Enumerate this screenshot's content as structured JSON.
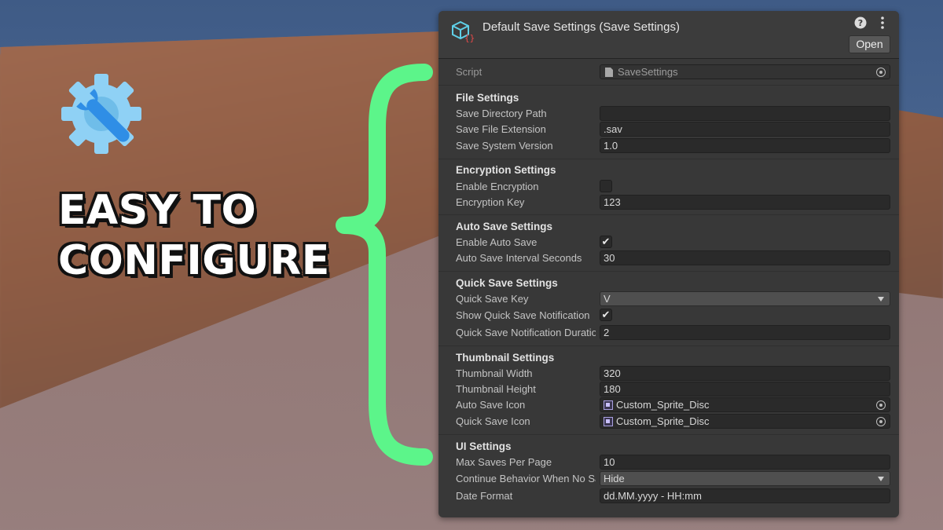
{
  "headline": {
    "line1": "EASY TO",
    "line2": "CONFIGURE"
  },
  "icons": {
    "gear": "gear-wrench-icon",
    "brace": "curly-brace-icon",
    "cube": "scriptable-object-icon",
    "help": "help-icon",
    "more": "more-options-icon"
  },
  "colors": {
    "brace": "#5cf58a",
    "gear": "#8fd1f5",
    "wrench": "#2f8ee6",
    "panel": "#383838"
  },
  "panel": {
    "title": "Default Save Settings (Save Settings)",
    "open_label": "Open",
    "script": {
      "label": "Script",
      "value": "SaveSettings"
    },
    "file": {
      "title": "File Settings",
      "dir_label": "Save Directory Path",
      "dir_value": "",
      "ext_label": "Save File Extension",
      "ext_value": ".sav",
      "ver_label": "Save System Version",
      "ver_value": "1.0"
    },
    "encryption": {
      "title": "Encryption Settings",
      "enable_label": "Enable Encryption",
      "enable_checked": false,
      "key_label": "Encryption Key",
      "key_value": "123"
    },
    "autosave": {
      "title": "Auto Save Settings",
      "enable_label": "Enable Auto Save",
      "enable_checked": true,
      "check": "✔",
      "interval_label": "Auto Save Interval Seconds",
      "interval_value": "30"
    },
    "quicksave": {
      "title": "Quick Save Settings",
      "key_label": "Quick Save Key",
      "key_value": "V",
      "notif_label": "Show Quick Save Notification",
      "notif_checked": true,
      "check": "✔",
      "duration_label": "Quick Save Notification Duratio",
      "duration_value": "2"
    },
    "thumbnail": {
      "title": "Thumbnail Settings",
      "width_label": "Thumbnail Width",
      "width_value": "320",
      "height_label": "Thumbnail Height",
      "height_value": "180",
      "autoicon_label": "Auto Save Icon",
      "autoicon_value": "Custom_Sprite_Disc",
      "quickicon_label": "Quick Save Icon",
      "quickicon_value": "Custom_Sprite_Disc"
    },
    "ui": {
      "title": "UI Settings",
      "maxsaves_label": "Max Saves Per Page",
      "maxsaves_value": "10",
      "continue_label": "Continue Behavior When No Sa",
      "continue_value": "Hide",
      "date_label": "Date Format",
      "date_value": "dd.MM.yyyy - HH:mm"
    }
  }
}
